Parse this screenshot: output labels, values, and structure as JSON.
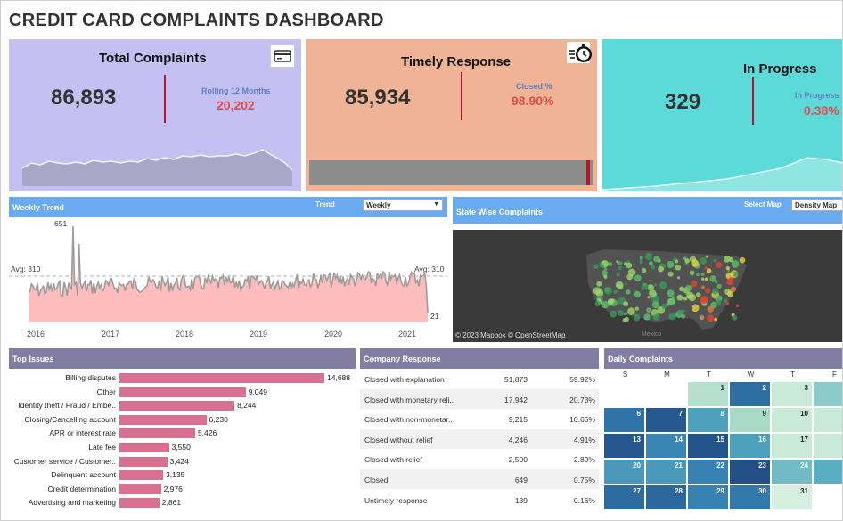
{
  "dashboard": {
    "title": "CREDIT CARD COMPLAINTS DASHBOARD"
  },
  "kpis": {
    "total": {
      "title": "Total Complaints",
      "value": "86,893",
      "sub_label": "Rolling 12 Months",
      "sub_value": "20,202",
      "icon": "credit-card-icon",
      "color": "#c4c1f2"
    },
    "timely": {
      "title": "Timely Response",
      "value": "85,934",
      "sub_label": "Closed %",
      "sub_value": "98.90%",
      "icon": "stopwatch-icon",
      "closed_fraction": 0.989,
      "color": "#efb496"
    },
    "progress": {
      "title": "In Progress",
      "value": "329",
      "sub_label": "In Progress",
      "sub_value": "0.38%",
      "color": "#5cdada"
    }
  },
  "weekly_trend": {
    "header": "Weekly Trend",
    "trend_label": "Trend",
    "trend_value": "Weekly",
    "avg_label": "Avg: 310",
    "avg_right_label": "Avg: 310",
    "max_label": "651",
    "min_label": "21",
    "years": [
      "2016",
      "2017",
      "2018",
      "2019",
      "2020",
      "2021"
    ],
    "header_color": "#6aaaf0"
  },
  "state_wise": {
    "header": "State Wise Complaints",
    "select_label": "Select Map",
    "select_value": "Density Map",
    "credit": "© 2023 Mapbox  © OpenStreetMap",
    "map_label": "Mexico"
  },
  "top_issues": {
    "header": "Top Issues",
    "header_color": "#827ea3",
    "bar_color": "#d87092",
    "items": [
      {
        "label": "Billing disputes",
        "value": 14688,
        "value_label": "14,688"
      },
      {
        "label": "Other",
        "value": 9049,
        "value_label": "9,049"
      },
      {
        "label": "Identity theft / Fraud / Embe..",
        "value": 8244,
        "value_label": "8,244"
      },
      {
        "label": "Closing/Cancelling account",
        "value": 6230,
        "value_label": "6,230"
      },
      {
        "label": "APR or interest rate",
        "value": 5426,
        "value_label": "5,426"
      },
      {
        "label": "Late fee",
        "value": 3550,
        "value_label": "3,550"
      },
      {
        "label": "Customer service / Customer..",
        "value": 3424,
        "value_label": "3,424"
      },
      {
        "label": "Delinquent account",
        "value": 3135,
        "value_label": "3,135"
      },
      {
        "label": "Credit determination",
        "value": 2976,
        "value_label": "2,976"
      },
      {
        "label": "Advertising and marketing",
        "value": 2861,
        "value_label": "2,861"
      }
    ]
  },
  "company_response": {
    "header": "Company Response",
    "rows": [
      {
        "label": "Closed with explanation",
        "count": "51,873",
        "pct": "59.92%"
      },
      {
        "label": "Closed with monetary reli..",
        "count": "17,942",
        "pct": "20.73%"
      },
      {
        "label": "Closed with non-monetar..",
        "count": "9,215",
        "pct": "10.65%"
      },
      {
        "label": "Closed without relief",
        "count": "4,246",
        "pct": "4.91%"
      },
      {
        "label": "Closed with relief",
        "count": "2,500",
        "pct": "2.89%"
      },
      {
        "label": "Closed",
        "count": "649",
        "pct": "0.75%"
      },
      {
        "label": "Untimely response",
        "count": "139",
        "pct": "0.16%"
      }
    ]
  },
  "daily_complaints": {
    "header": "Daily Complaints",
    "weekdays": [
      "S",
      "M",
      "T",
      "W",
      "T",
      "F"
    ],
    "cells": [
      {
        "day": "1",
        "row": 0,
        "col": 2,
        "color": "#b6dfd0"
      },
      {
        "day": "2",
        "row": 0,
        "col": 3,
        "color": "#2e6fa3"
      },
      {
        "day": "3",
        "row": 0,
        "col": 4,
        "color": "#c9ead7"
      },
      {
        "day": "",
        "row": 0,
        "col": 5,
        "color": "#8ccac9"
      },
      {
        "day": "6",
        "row": 1,
        "col": 0,
        "color": "#2f73a8"
      },
      {
        "day": "7",
        "row": 1,
        "col": 1,
        "color": "#25598f"
      },
      {
        "day": "8",
        "row": 1,
        "col": 2,
        "color": "#4ea1bd"
      },
      {
        "day": "9",
        "row": 1,
        "col": 3,
        "color": "#a9dac8"
      },
      {
        "day": "10",
        "row": 1,
        "col": 4,
        "color": "#c9ead7"
      },
      {
        "day": "",
        "row": 1,
        "col": 5,
        "color": "#c9ead7"
      },
      {
        "day": "13",
        "row": 2,
        "col": 0,
        "color": "#24578e"
      },
      {
        "day": "14",
        "row": 2,
        "col": 1,
        "color": "#3a86b3"
      },
      {
        "day": "15",
        "row": 2,
        "col": 2,
        "color": "#22538a"
      },
      {
        "day": "16",
        "row": 2,
        "col": 3,
        "color": "#4ea1bd"
      },
      {
        "day": "17",
        "row": 2,
        "col": 4,
        "color": "#c9ead7"
      },
      {
        "day": "",
        "row": 2,
        "col": 5,
        "color": "#c9ead7"
      },
      {
        "day": "20",
        "row": 3,
        "col": 0,
        "color": "#4a99bb"
      },
      {
        "day": "21",
        "row": 3,
        "col": 1,
        "color": "#4a99bb"
      },
      {
        "day": "22",
        "row": 3,
        "col": 2,
        "color": "#3882b1"
      },
      {
        "day": "23",
        "row": 3,
        "col": 3,
        "color": "#234f86"
      },
      {
        "day": "24",
        "row": 3,
        "col": 4,
        "color": "#73bbc4"
      },
      {
        "day": "",
        "row": 3,
        "col": 5,
        "color": "#5aaec2"
      },
      {
        "day": "27",
        "row": 4,
        "col": 0,
        "color": "#2d6ca1"
      },
      {
        "day": "28",
        "row": 4,
        "col": 1,
        "color": "#2b689e"
      },
      {
        "day": "29",
        "row": 4,
        "col": 2,
        "color": "#3882b1"
      },
      {
        "day": "30",
        "row": 4,
        "col": 3,
        "color": "#3378ab"
      },
      {
        "day": "31",
        "row": 4,
        "col": 4,
        "color": "#d6efdf"
      },
      {
        "day": "",
        "row": 4,
        "col": 5,
        "color": "#ffffff"
      }
    ]
  }
}
